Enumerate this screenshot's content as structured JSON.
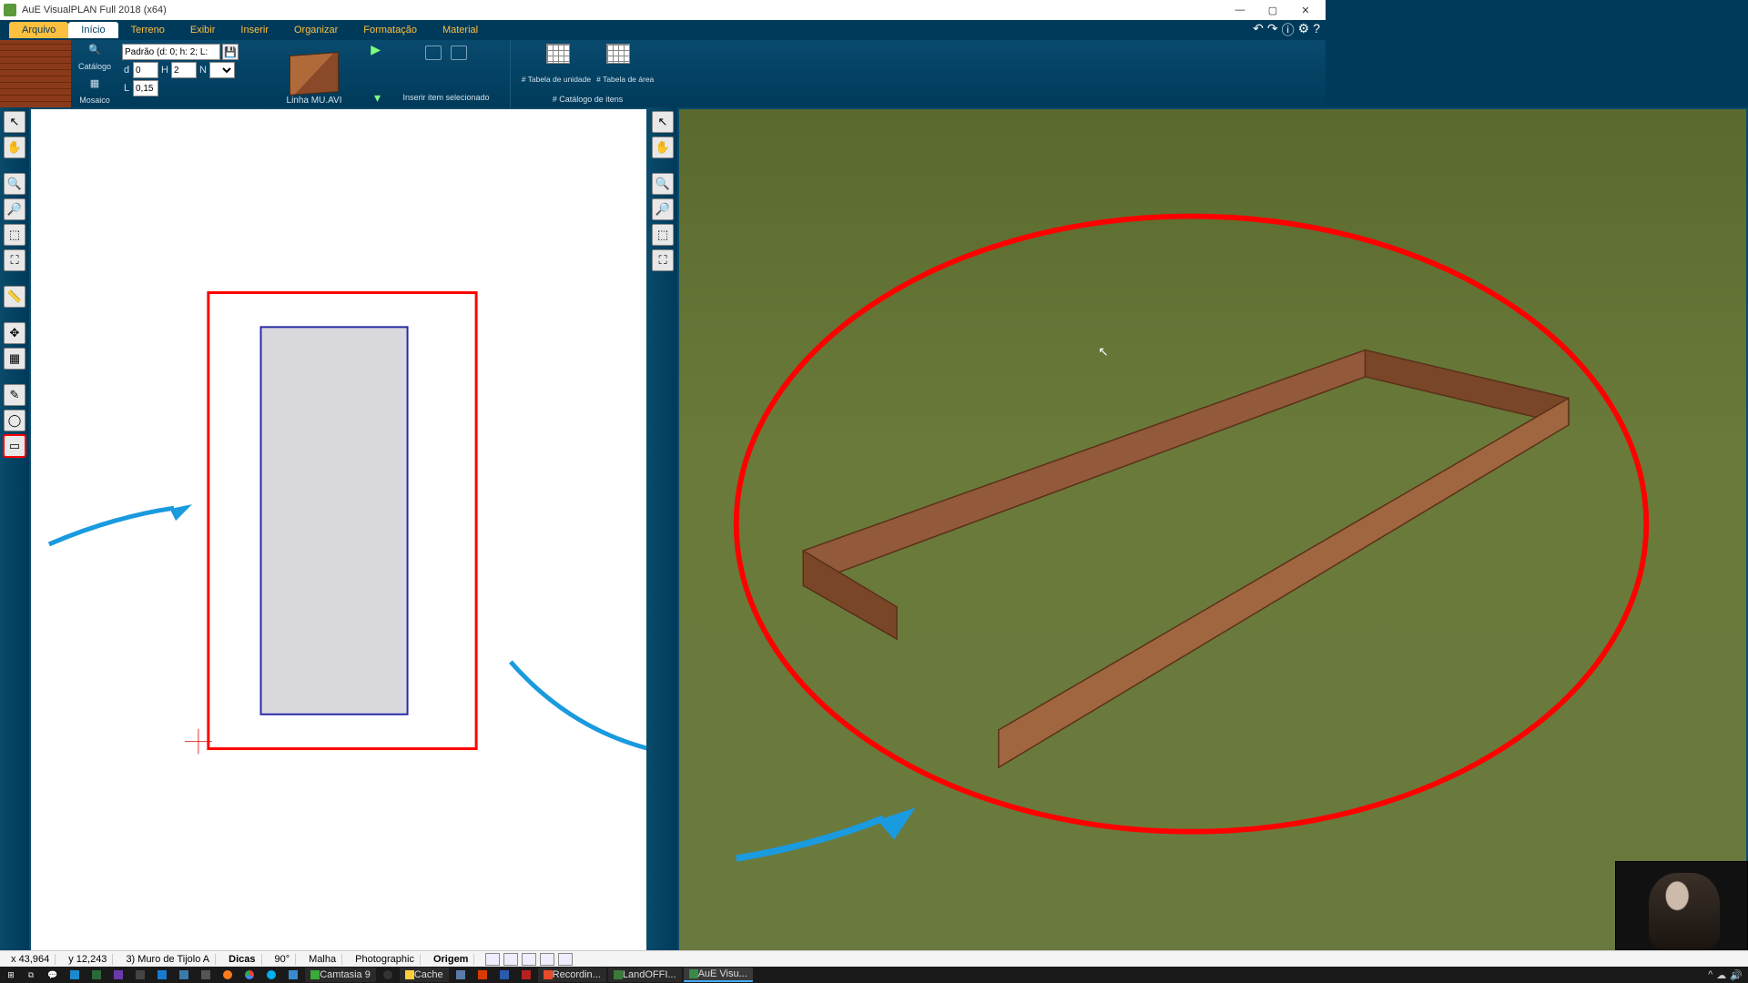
{
  "window": {
    "title": "AuE VisualPLAN Full 2018 (x64)"
  },
  "menu": {
    "arquivo": "Arquivo",
    "inicio": "Início",
    "terreno": "Terreno",
    "exibir": "Exibir",
    "inserir": "Inserir",
    "organizar": "Organizar",
    "formatacao": "Formatação",
    "material": "Material"
  },
  "ribbon": {
    "catalogo": "Catálogo",
    "mosaico": "Mosaico",
    "padrao": "Padrão (d: 0; h: 2; L:",
    "d_lbl": "d",
    "d_val": "0",
    "h_lbl": "H",
    "h_val": "2",
    "n_lbl": "N",
    "l_lbl": "L",
    "l_val": "0,15",
    "linha": "Linha MU.AVI",
    "inserir_item": "Inserir item selecionado",
    "tab_unidade": "# Tabela de unidade",
    "tab_area": "# Tabela de área",
    "catalogo_itens": "# Catálogo de itens"
  },
  "status": {
    "x_lbl": "x",
    "x_val": "43,964",
    "y_lbl": "y",
    "y_val": "12,243",
    "layer": "3) Muro de Tijolo A",
    "dicas": "Dicas",
    "angle": "90°",
    "malha": "Malha",
    "photo": "Photographic",
    "origem": "Origem"
  },
  "taskbar": {
    "camtasia": "Camtasia 9",
    "cache": "Cache",
    "recording": "Recordin...",
    "landoffice": "LandOFFI...",
    "aue": "AuE Visu..."
  },
  "icons": {
    "search": "🔍",
    "hand": "✋",
    "arrow": "↖",
    "zoomin": "🔍+",
    "zoomout": "🔍-",
    "zoomfit": "⛶",
    "grid": "▦",
    "measure": "📏",
    "move": "✥",
    "layers": "☰",
    "pencil": "✎",
    "circle": "◯",
    "rect": "▭"
  },
  "colors": {
    "annotation_red": "#ff0000",
    "annotation_blue": "#1a9adf",
    "wall_brick": "#8a4a2a",
    "ground": "#6a7a3a"
  }
}
